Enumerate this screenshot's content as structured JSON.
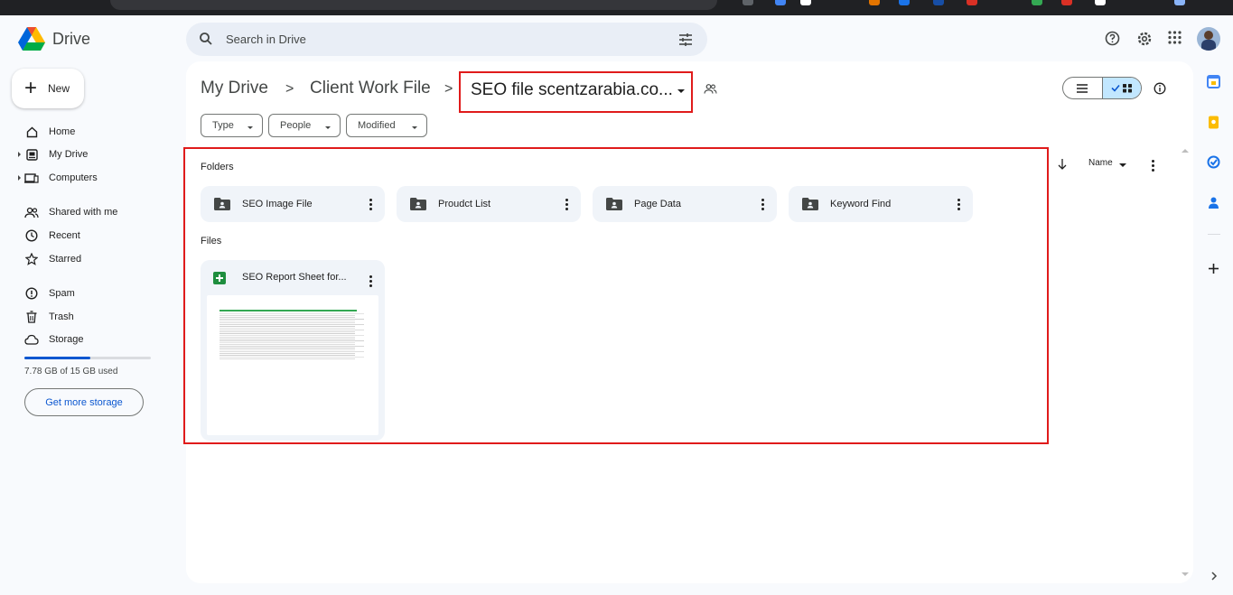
{
  "app": {
    "brand": "Drive"
  },
  "search": {
    "placeholder": "Search in Drive"
  },
  "new_button": {
    "label": "New"
  },
  "sidebar": {
    "items": [
      {
        "label": "Home",
        "icon": "home-icon"
      },
      {
        "label": "My Drive",
        "icon": "my-drive-icon"
      },
      {
        "label": "Computers",
        "icon": "computer-icon"
      },
      {
        "label": "Shared with me",
        "icon": "people-icon"
      },
      {
        "label": "Recent",
        "icon": "clock-icon"
      },
      {
        "label": "Starred",
        "icon": "star-icon"
      },
      {
        "label": "Spam",
        "icon": "spam-icon"
      },
      {
        "label": "Trash",
        "icon": "trash-icon"
      },
      {
        "label": "Storage",
        "icon": "cloud-icon"
      }
    ],
    "storage_text": "7.78 GB of 15 GB used",
    "storage_used_fraction": 0.52,
    "get_storage_label": "Get more storage"
  },
  "breadcrumb": {
    "items": [
      "My Drive",
      "Client Work File"
    ],
    "separator": ">",
    "current": "SEO file scentzarabia.co..."
  },
  "filters": [
    "Type",
    "People",
    "Modified"
  ],
  "sort": {
    "label": "Name"
  },
  "folders_section": {
    "label": "Folders",
    "folders": [
      "SEO Image File",
      "Proudct List",
      "Page Data",
      "Keyword Find"
    ]
  },
  "files_section": {
    "label": "Files",
    "files": [
      {
        "name": "SEO Report Sheet for...",
        "type": "sheets-icon"
      }
    ]
  },
  "colors": {
    "accent": "#0b57d0",
    "highlight_box": "#e01b1b",
    "selected_view": "#c2e7ff",
    "sheets_green": "#1e8e3e"
  }
}
